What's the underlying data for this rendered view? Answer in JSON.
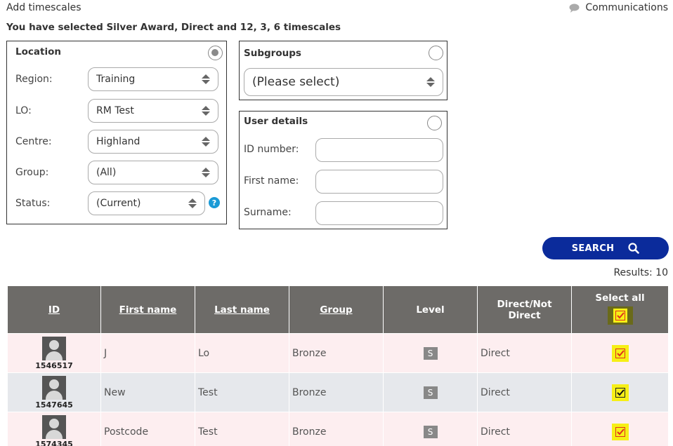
{
  "header": {
    "title": "Add timescales",
    "communications_label": "Communications",
    "selected_summary": "You have selected Silver Award, Direct and 12, 3, 6 timescales"
  },
  "location_panel": {
    "title": "Location",
    "selected": true,
    "fields": [
      {
        "label": "Region:",
        "value": "Training"
      },
      {
        "label": "LO:",
        "value": "RM Test"
      },
      {
        "label": "Centre:",
        "value": "Highland"
      },
      {
        "label": "Group:",
        "value": "(All)"
      },
      {
        "label": "Status:",
        "value": "(Current)"
      }
    ],
    "help_glyph": "?"
  },
  "subgroups_panel": {
    "title": "Subgroups",
    "selected": false,
    "value": "(Please select)"
  },
  "user_details_panel": {
    "title": "User details",
    "selected": false,
    "fields": [
      {
        "label": "ID number:",
        "value": ""
      },
      {
        "label": "First name:",
        "value": ""
      },
      {
        "label": "Surname:",
        "value": ""
      }
    ]
  },
  "search_button_label": "SEARCH",
  "results_label": "Results: 10",
  "table": {
    "headers": {
      "id": "ID",
      "first_name": "First name",
      "last_name": "Last name",
      "group": "Group",
      "level": "Level",
      "direct": "Direct/Not Direct",
      "select_all": "Select all"
    },
    "rows": [
      {
        "id": "1546517",
        "first_name": "J",
        "last_name": "Lo",
        "group": "Bronze",
        "level": "S",
        "direct": "Direct",
        "checked": true
      },
      {
        "id": "1547645",
        "first_name": "New",
        "last_name": "Test",
        "group": "Bronze",
        "level": "S",
        "direct": "Direct",
        "checked": true
      },
      {
        "id": "1574345",
        "first_name": "Postcode",
        "last_name": "Test",
        "group": "Bronze",
        "level": "S",
        "direct": "Direct",
        "checked": true
      }
    ]
  },
  "colors": {
    "search_button": "#0b2b9b",
    "table_header": "#6d6b68",
    "row_pink": "#fdeef0",
    "row_grey": "#e6e8ec",
    "checkbox_highlight": "#f6ef16",
    "help_icon": "#1a9ad6"
  }
}
